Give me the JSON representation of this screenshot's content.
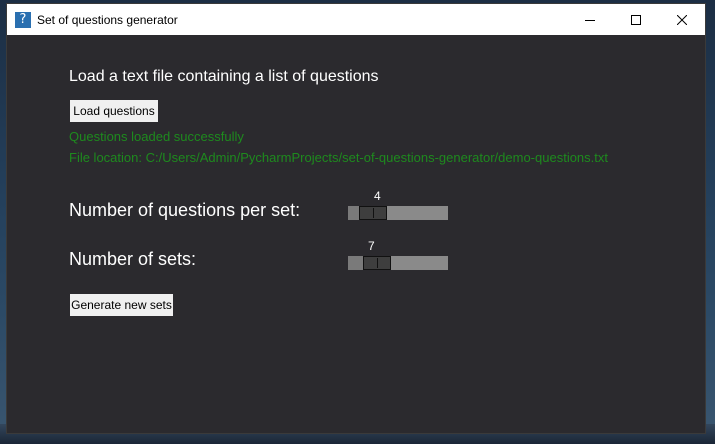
{
  "window": {
    "title": "Set of questions generator",
    "icon": "question-mark-icon"
  },
  "main": {
    "heading": "Load a text file containing a list of questions",
    "load_button": "Load questions",
    "status_message": "Questions loaded successfully",
    "file_location": "File location: C:/Users/Admin/PycharmProjects/set-of-questions-generator/demo-questions.txt",
    "questions_per_set": {
      "label": "Number of questions per set:",
      "value": "4",
      "min": 1,
      "max": 20
    },
    "number_of_sets": {
      "label": "Number of sets:",
      "value": "7",
      "min": 1,
      "max": 30
    },
    "generate_button": "Generate new sets"
  },
  "colors": {
    "background": "#2b2a2e",
    "status_text": "#1e8a1e",
    "slider_track": "#8a8a8a",
    "slider_handle": "#3e3e3e"
  }
}
